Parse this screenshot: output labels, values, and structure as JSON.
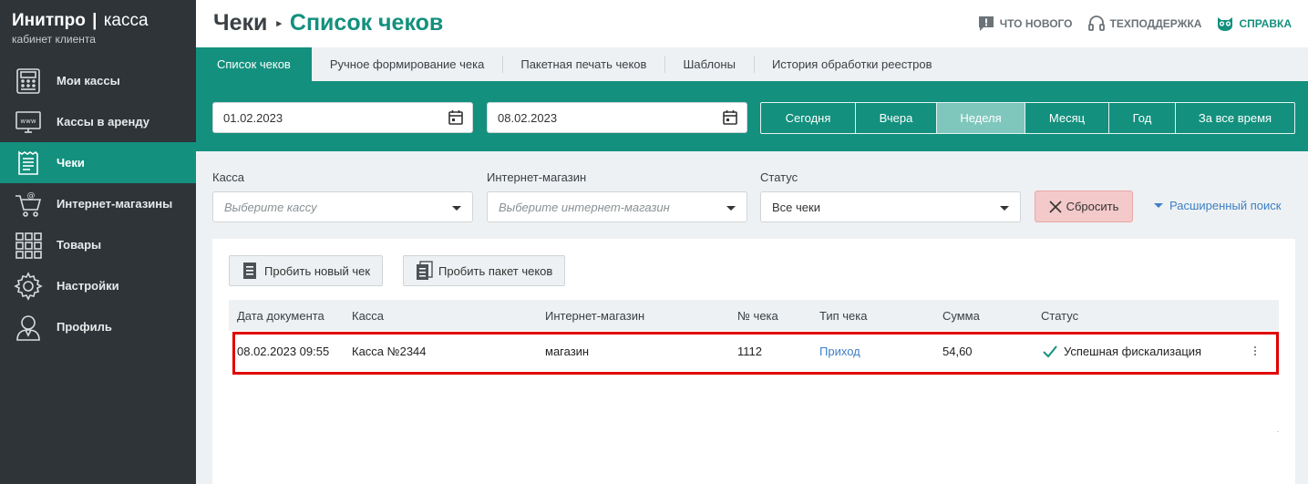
{
  "brand": {
    "name_bold": "Инитпро",
    "separator": "|",
    "name_light": "касса",
    "subtitle": "кабинет клиента"
  },
  "sidebar": {
    "items": [
      {
        "label": "Мои кассы",
        "icon": "cash-register-icon",
        "active": false
      },
      {
        "label": "Кассы в аренду",
        "icon": "www-monitor-icon",
        "active": false
      },
      {
        "label": "Чеки",
        "icon": "receipt-icon",
        "active": true
      },
      {
        "label": "Интернет-магазины",
        "icon": "shopping-cart-icon",
        "active": false
      },
      {
        "label": "Товары",
        "icon": "grid-icon",
        "active": false
      },
      {
        "label": "Настройки",
        "icon": "gear-icon",
        "active": false
      },
      {
        "label": "Профиль",
        "icon": "user-icon",
        "active": false
      }
    ]
  },
  "header": {
    "crumb_root": "Чеки",
    "crumb_arrow": "▸",
    "crumb_current": "Список чеков",
    "links": {
      "news": "ЧТО НОВОГО",
      "support": "ТЕХПОДДЕРЖКА",
      "help": "СПРАВКА"
    }
  },
  "tabs": [
    {
      "label": "Список чеков",
      "active": true
    },
    {
      "label": "Ручное формирование чека",
      "active": false
    },
    {
      "label": "Пакетная печать чеков",
      "active": false
    },
    {
      "label": "Шаблоны",
      "active": false
    },
    {
      "label": "История обработки реестров",
      "active": false
    }
  ],
  "dates": {
    "from": "01.02.2023",
    "to": "08.02.2023"
  },
  "periods": [
    {
      "label": "Сегодня",
      "active": false
    },
    {
      "label": "Вчера",
      "active": false
    },
    {
      "label": "Неделя",
      "active": true
    },
    {
      "label": "Месяц",
      "active": false
    },
    {
      "label": "Год",
      "active": false
    },
    {
      "label": "За все время",
      "active": false
    }
  ],
  "filters": {
    "kassa_label": "Касса",
    "kassa_placeholder": "Выберите кассу",
    "shop_label": "Интернет-магазин",
    "shop_placeholder": "Выберите интернет-магазин",
    "status_label": "Статус",
    "status_value": "Все чеки",
    "reset_label": "Сбросить",
    "advanced_label": "Расширенный поиск"
  },
  "actions": {
    "new_check": "Пробить новый чек",
    "batch_check": "Пробить пакет чеков"
  },
  "table": {
    "columns": [
      "Дата документа",
      "Касса",
      "Интернет-магазин",
      "№ чека",
      "Тип чека",
      "Сумма",
      "Статус"
    ],
    "rows": [
      {
        "date": "08.02.2023 09:55",
        "kassa": "Касса №2344",
        "shop": "магазин",
        "number": "1112",
        "type": "Приход",
        "sum": "54,60",
        "status": "Успешная фискализация"
      }
    ]
  },
  "colors": {
    "accent": "#13907e",
    "sidebar_bg": "#2e3438",
    "link": "#3f7fc4",
    "highlight": "#e00000"
  }
}
